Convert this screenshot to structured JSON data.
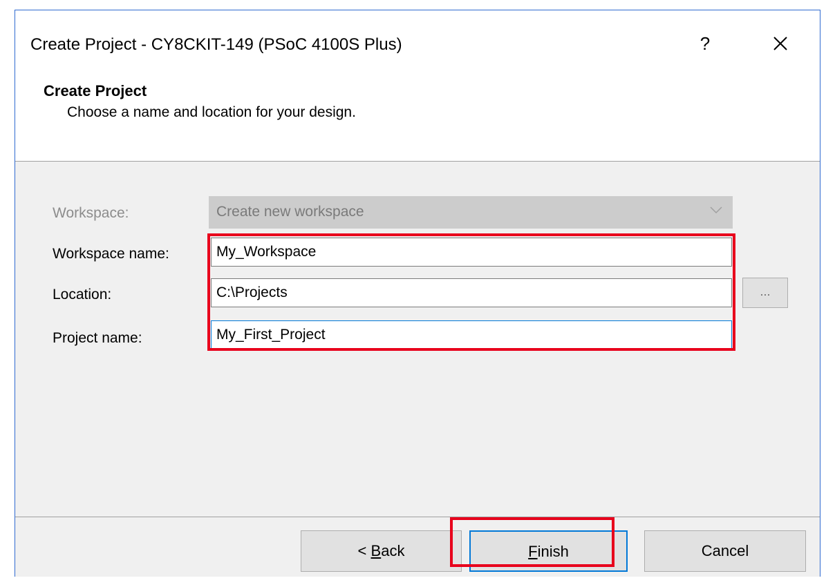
{
  "window": {
    "title": "Create Project - CY8CKIT-149 (PSoC 4100S Plus)",
    "help_label": "?",
    "close_icon": "close-icon"
  },
  "header": {
    "title": "Create Project",
    "subtitle": "Choose a name and location for your design."
  },
  "form": {
    "workspace_label": "Workspace:",
    "workspace_value": "Create new workspace",
    "workspace_name_label": "Workspace name:",
    "workspace_name_value": "My_Workspace",
    "location_label": "Location:",
    "location_value": "C:\\Projects",
    "browse_label": "...",
    "project_name_label": "Project name:",
    "project_name_value": "My_First_Project"
  },
  "footer": {
    "back_prefix": "< ",
    "back_accel": "B",
    "back_rest": "ack",
    "finish_accel": "F",
    "finish_rest": "inish",
    "cancel_label": "Cancel"
  },
  "colors": {
    "highlight": "#e8001c",
    "focus": "#0078d7"
  }
}
